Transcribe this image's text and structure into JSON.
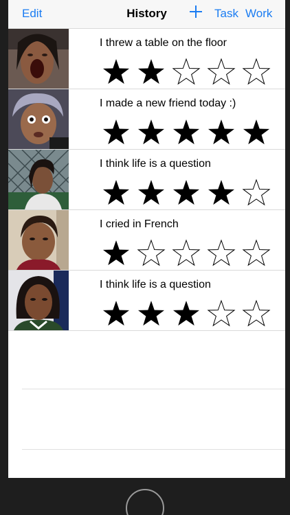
{
  "nav": {
    "edit_label": "Edit",
    "title": "History",
    "add_icon": "plus-icon",
    "task_label": "Task",
    "work_label": "Work"
  },
  "colors": {
    "accent": "#1a7cf2"
  },
  "max_rating": 5,
  "entries": [
    {
      "text": "I threw a table on the floor",
      "rating": 2,
      "photo": "face-photo"
    },
    {
      "text": "I made a new friend today :)",
      "rating": 5,
      "photo": "face-photo"
    },
    {
      "text": "I think life is a question",
      "rating": 4,
      "photo": "face-photo"
    },
    {
      "text": "I cried in French",
      "rating": 1,
      "photo": "face-photo"
    },
    {
      "text": "I think life is a question",
      "rating": 3,
      "photo": "face-photo"
    }
  ]
}
